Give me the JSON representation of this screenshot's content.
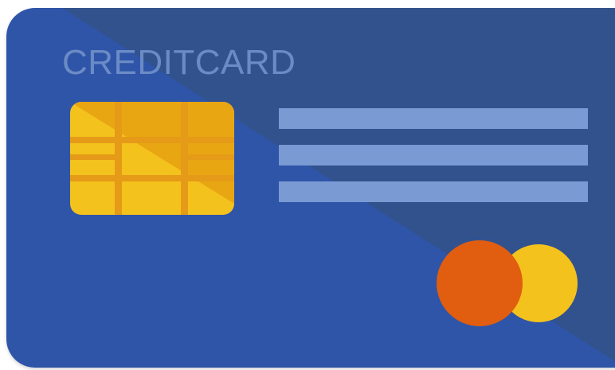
{
  "card": {
    "title": "CREDITCARD",
    "colors": {
      "body": "#2f55a8",
      "body_shade": "#32528e",
      "title_text": "#6b8bc6",
      "stripes": "#7a9ad3",
      "chip_light": "#f4c21c",
      "chip_dark": "#e8a613",
      "chip_lines": "#e59a18",
      "logo_left": "#e15d10",
      "logo_right": "#f4c21c"
    },
    "icons": {
      "chip": "emv-chip-icon",
      "logo": "card-brand-logo-icon"
    }
  }
}
